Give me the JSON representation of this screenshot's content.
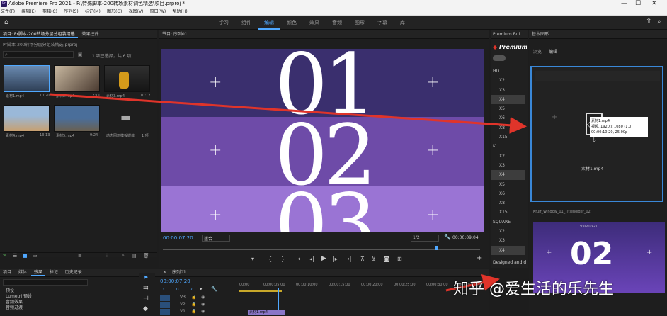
{
  "window": {
    "title": "Adobe Premiere Pro 2021 - F:\\特殊脚本-200转场素材调色精选\\项目.prproj *",
    "controls": [
      "—",
      "☐",
      "✕"
    ]
  },
  "menu": [
    "文件(F)",
    "编辑(E)",
    "剪辑(C)",
    "序列(S)",
    "标记(M)",
    "图形(G)",
    "视图(V)",
    "窗口(W)",
    "帮助(H)"
  ],
  "workspaces": {
    "items": [
      "学习",
      "组件",
      "编辑",
      "颜色",
      "效果",
      "音频",
      "图形",
      "字幕",
      "库"
    ],
    "active_index": 2
  },
  "project_panel": {
    "tabs": [
      "项目: Pr脚本-200转场分层分组装精选",
      "效果控件"
    ],
    "path": "Pr脚本-200转场分层分组装精选.prproj",
    "item_count": "1 项已选择，共 6 项",
    "clips": [
      {
        "name": "素材1.mp4",
        "duration": "10:20"
      },
      {
        "name": "素材2.mp4",
        "duration": "12:11"
      },
      {
        "name": "素材3.mp4",
        "duration": "10:12"
      },
      {
        "name": "素材4.mp4",
        "duration": "13:13"
      },
      {
        "name": "素材5.mp4",
        "duration": "9:24"
      },
      {
        "name": "动态图形模板媒体",
        "duration": "1 项"
      }
    ]
  },
  "monitor": {
    "title": "节目: 序列01",
    "numbers": [
      "01",
      "02",
      "03"
    ],
    "timecode": "00:00:07:20",
    "fit": "适合",
    "ratio": "1/2",
    "duration": "00:00:09:04",
    "colors": {
      "top": "#3a2f6e",
      "middle": "#6e4ba8",
      "bottom": "#9a74d4"
    }
  },
  "premiumbeat": {
    "header": "Premium Bui",
    "brand": "Premium",
    "sections": [
      {
        "label": "HD",
        "items": [
          "X2",
          "X3",
          "X4",
          "X5",
          "X6",
          "X8",
          "X15"
        ]
      },
      {
        "label": "K",
        "items": [
          "X2",
          "X3",
          "X4",
          "X5",
          "X6",
          "X8",
          "X15"
        ]
      },
      {
        "label": "SQUARE",
        "items": [
          "X2",
          "X3",
          "X4"
        ]
      }
    ],
    "highlight_items": [
      "HD-X4",
      "K-X4",
      "SQUARE-X4"
    ],
    "footer": "Designed and d"
  },
  "source_panel": {
    "tabs": [
      "基本图形",
      "浏览",
      "编辑"
    ],
    "file": "素材1.mp4",
    "info_line1": "视频, 1920 x 1080 (1.0)",
    "info_line2": "00:00:10:20, 25.00p",
    "drop_label": "素材1.mp4",
    "mogrt": "Kfulr_Window_01_Titleholder_02",
    "mogrt_subtitle": "YOUR LOGO"
  },
  "effects_panel": {
    "tabs": [
      "项目",
      "媒体",
      "效果",
      "标记",
      "历史记录"
    ],
    "items": [
      "预设",
      "Lumetri 预设",
      "音频效果",
      "音频过渡"
    ]
  },
  "timeline": {
    "title": "序列01",
    "timecode": "00:00:07:20",
    "ruler": [
      "00:00",
      "00:00:05:00",
      "00:00:10:00",
      "00:00:15:00",
      "00:00:20:00",
      "00:00:25:00",
      "00:00:30:00",
      "00:00:35:00"
    ],
    "tracks": [
      "V3",
      "V2",
      "V1"
    ],
    "clip_label": "素材1.mp4"
  },
  "watermark": "知乎 @爱生活的乐先生",
  "arrow_color": "#e0342a"
}
